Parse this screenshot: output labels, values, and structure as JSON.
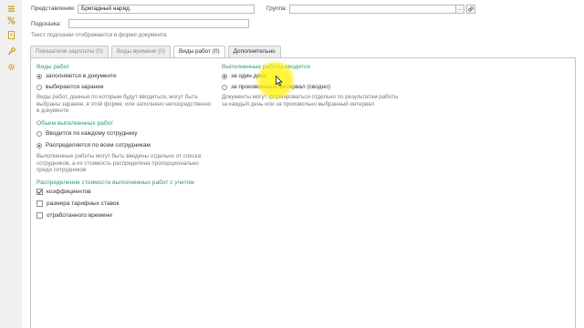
{
  "sidebar": {
    "icons": [
      "list-icon",
      "percent-icon",
      "document-icon",
      "wrench-icon",
      "gear-icon"
    ],
    "accent": "#c9a227"
  },
  "form": {
    "view_label": "Представление:",
    "view_value": "Бригадный наряд",
    "group_label": "Группа:",
    "group_value": "",
    "hint_label": "Подсказка:",
    "hint_value": "",
    "hint_note": "Текст подсказки отображается в форме документа"
  },
  "tabs": [
    {
      "label": "Показатели зарплаты (0)",
      "active": false
    },
    {
      "label": "Виды времени (0)",
      "active": false
    },
    {
      "label": "Виды работ (0)",
      "active": true
    },
    {
      "label": "Дополнительно",
      "active": false
    }
  ],
  "work_types": {
    "title": "Виды работ",
    "option1": "заполняются в документе",
    "option2": "выбираются заранее",
    "description": [
      "Виды работ, данные по которым будут вводиться, могут быть",
      "выбраны заранее, в этой форме, или заполнено непосредственно",
      "в документе"
    ]
  },
  "entry": {
    "title": "Выполненные работы вводятся",
    "option1": "за один день",
    "option2": "за произвольный интервал (сводно)",
    "description": [
      "Документы могут формироваться отдельно по результатам работы",
      "за каждый день или за произвольно выбранный интервал"
    ]
  },
  "volume": {
    "title": "Объем выполненных работ",
    "option1": "Вводится по каждому сотруднику",
    "option2": "Распределяется по всем сотрудникам",
    "description": [
      "Выполненные работы могут быть введены отдельно от списка",
      "сотрудников, а их стоимость распределена пропорционально",
      "среди сотрудников"
    ]
  },
  "distribution": {
    "title": "Распределение стоимости выполненных работ с учетом",
    "option1": "коэффициентов",
    "option2": "размера тарифных ставок",
    "option3": "отработанного времени",
    "checked": [
      true,
      false,
      false
    ]
  },
  "colors": {
    "group_title": "#2f9b6a",
    "highlight": "#fff200"
  }
}
